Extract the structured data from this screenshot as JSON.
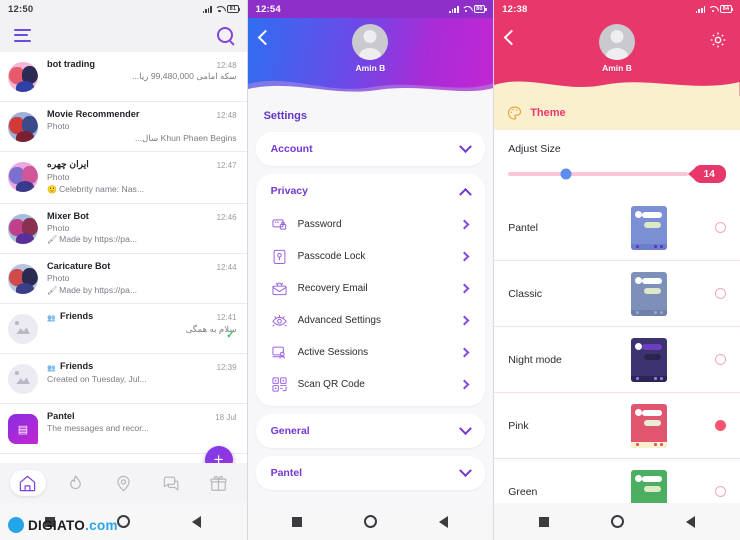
{
  "left": {
    "status": {
      "time": "12:50",
      "battery": "81"
    },
    "topbar": {
      "menu_icon": "hamburger-menu-icon",
      "search_icon": "search-icon"
    },
    "chats": [
      {
        "title": "bot trading",
        "sub1": "",
        "sub2": "سکه امامی 99,480,000 ریا...",
        "time": "12:48",
        "rtl": true,
        "avatar": "bot-avatar",
        "emoji": "",
        "group": false,
        "tick": false
      },
      {
        "title": "Movie Recommender",
        "sub1": "Photo",
        "sub2": "Khun Phaen Begins سال...",
        "time": "12:48",
        "rtl": true,
        "avatar": "bot-avatar",
        "emoji": "",
        "group": false,
        "tick": false
      },
      {
        "title": "ایران چهره",
        "sub1": "Photo",
        "sub2": "Celebrity name: Nas...",
        "time": "12:47",
        "rtl": false,
        "avatar": "bot-avatar",
        "emoji": "🙂",
        "group": false,
        "tick": false
      },
      {
        "title": "Mixer Bot",
        "sub1": "Photo",
        "sub2": "Made by https://pa...",
        "time": "12:46",
        "rtl": false,
        "avatar": "bot-avatar",
        "emoji": "🖌",
        "group": false,
        "tick": false
      },
      {
        "title": "Caricature Bot",
        "sub1": "Photo",
        "sub2": "Made by https://pa...",
        "time": "12:44",
        "rtl": false,
        "avatar": "bot-avatar",
        "emoji": "🖌",
        "group": false,
        "tick": false
      },
      {
        "title": "Friends",
        "sub1": "",
        "sub2": "سلام به همگی",
        "time": "12:41",
        "rtl": true,
        "avatar": "placeholder-avatar",
        "emoji": "",
        "group": true,
        "tick": true
      },
      {
        "title": "Friends",
        "sub1": "",
        "sub2": "Created on Tuesday, Jul...",
        "time": "12:39",
        "rtl": false,
        "avatar": "placeholder-avatar",
        "emoji": "",
        "group": true,
        "tick": false
      },
      {
        "title": "Pantel",
        "sub1": "",
        "sub2": "The messages and recor...",
        "time": "18 Jul",
        "rtl": false,
        "avatar": "pantel-avatar",
        "emoji": "",
        "group": false,
        "tick": false
      }
    ],
    "fab_label": "+",
    "bottomnav": [
      {
        "name": "home-icon",
        "active": true
      },
      {
        "name": "flame-icon",
        "active": false
      },
      {
        "name": "location-pin-icon",
        "active": false
      },
      {
        "name": "chat-icon",
        "active": false
      },
      {
        "name": "gift-icon",
        "active": false
      }
    ],
    "watermark": {
      "brand": "DIGIATO",
      "suffix": ".com"
    }
  },
  "middle": {
    "status": {
      "time": "12:54",
      "battery": "80"
    },
    "header": {
      "back_icon": "back-chevron-icon",
      "avatar_name": "Amin B"
    },
    "page_title": "Settings",
    "sections": [
      {
        "label": "Account",
        "expanded": false,
        "items": []
      },
      {
        "label": "Privacy",
        "expanded": true,
        "items": [
          {
            "label": "Password",
            "icon": "password-icon"
          },
          {
            "label": "Passcode Lock",
            "icon": "passcode-lock-icon"
          },
          {
            "label": "Recovery Email",
            "icon": "recovery-email-icon"
          },
          {
            "label": "Advanced Settings",
            "icon": "eye-settings-icon"
          },
          {
            "label": "Active Sessions",
            "icon": "active-sessions-icon"
          },
          {
            "label": "Scan QR Code",
            "icon": "qr-code-icon"
          }
        ]
      },
      {
        "label": "General",
        "expanded": false,
        "items": []
      },
      {
        "label": "Pantel",
        "expanded": false,
        "items": []
      }
    ]
  },
  "right": {
    "status": {
      "time": "12:38",
      "battery": "84"
    },
    "header": {
      "back_icon": "back-chevron-icon",
      "avatar_name": "Amin B",
      "gear_icon": "gear-icon"
    },
    "theme_band": {
      "icon": "palette-icon",
      "label": "Theme"
    },
    "adjust": {
      "label": "Adjust Size",
      "value": "14",
      "percent": 32
    },
    "themes": [
      {
        "name": "Pantel",
        "selected": false,
        "bg": "#7b8fd4",
        "foot": "#6b7fc8",
        "avatar": "#ffffff",
        "bar1": "#ffffff",
        "bar2": "#dde8c6",
        "dot": "#6a2fd0"
      },
      {
        "name": "Classic",
        "selected": false,
        "bg": "#7d90ba",
        "foot": "#7080aa",
        "avatar": "#ffffff",
        "bar1": "#ffffff",
        "bar2": "#dde8c6",
        "dot": "#9aa8c8"
      },
      {
        "name": "Night mode",
        "selected": false,
        "bg": "#3c3370",
        "foot": "#2c2455",
        "avatar": "#ffffff",
        "bar1": "#6b3fc0",
        "bar2": "#2b2450",
        "dot": "#8f7fe0"
      },
      {
        "name": "Pink",
        "selected": true,
        "bg": "#e0566f",
        "foot": "#fbf0cd",
        "avatar": "#ffffff",
        "bar1": "#ffffff",
        "bar2": "#e7efd0",
        "dot": "#e0566f"
      },
      {
        "name": "Green",
        "selected": false,
        "bg": "#4cae62",
        "foot": "#3f9a54",
        "avatar": "#ffffff",
        "bar1": "#ffffff",
        "bar2": "#dbebc4",
        "dot": "#3f9a54"
      }
    ]
  },
  "colors": {
    "purple": "#7437d4",
    "pink": "#e8386b",
    "cream": "#fbf0cd",
    "blue_accent": "#5e8df0"
  }
}
